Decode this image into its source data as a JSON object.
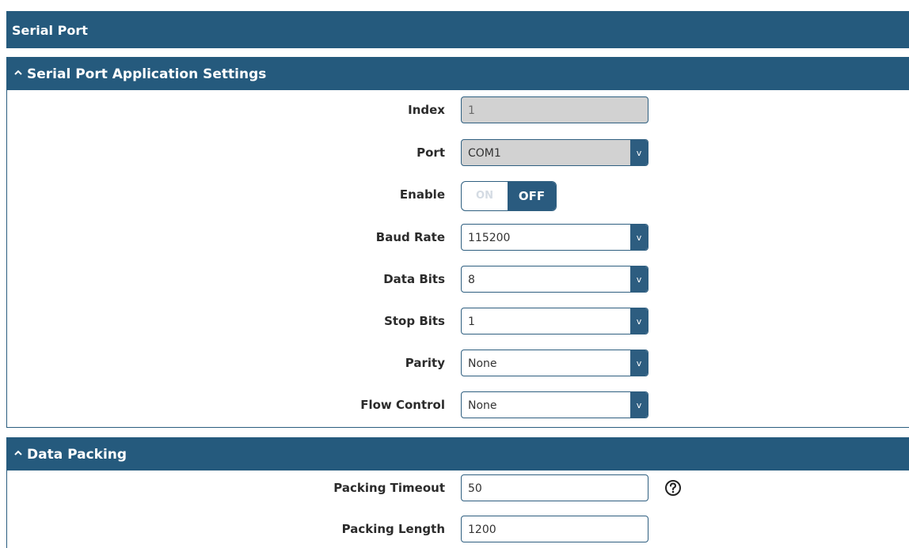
{
  "page": {
    "title": "Serial Port"
  },
  "sections": {
    "app_settings": {
      "header": "Serial Port Application Settings",
      "index": {
        "label": "Index",
        "value": "1"
      },
      "port": {
        "label": "Port",
        "value": "COM1"
      },
      "enable": {
        "label": "Enable",
        "on_label": "ON",
        "off_label": "OFF",
        "state": "OFF"
      },
      "baud_rate": {
        "label": "Baud Rate",
        "value": "115200"
      },
      "data_bits": {
        "label": "Data Bits",
        "value": "8"
      },
      "stop_bits": {
        "label": "Stop Bits",
        "value": "1"
      },
      "parity": {
        "label": "Parity",
        "value": "None"
      },
      "flow_control": {
        "label": "Flow Control",
        "value": "None"
      }
    },
    "data_packing": {
      "header": "Data Packing",
      "packing_timeout": {
        "label": "Packing Timeout",
        "value": "50"
      },
      "packing_length": {
        "label": "Packing Length",
        "value": "1200"
      }
    }
  },
  "icons": {
    "chevron": "chevron-up-icon",
    "dropdown": "chevron-down-icon",
    "help": "help-icon"
  },
  "colors": {
    "header_bg": "#255a7d",
    "border": "#2f5f80",
    "readonly_bg": "#d2d2d2",
    "toggle_off_bg": "#2a5b7f"
  }
}
